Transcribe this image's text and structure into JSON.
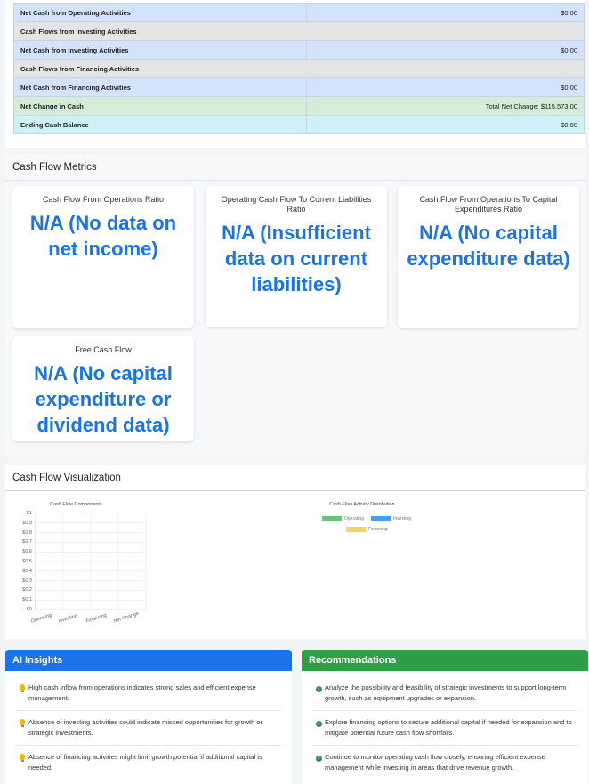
{
  "statement": {
    "rows": [
      {
        "label": "Net Cash from Operating Activities",
        "value": "$0.00",
        "style": "blue"
      },
      {
        "label": "Cash Flows from Investing Activities",
        "value": "",
        "style": "gray"
      },
      {
        "label": "Net Cash from Investing Activities",
        "value": "$0.00",
        "style": "blue"
      },
      {
        "label": "Cash Flows from Financing Activities",
        "value": "",
        "style": "gray"
      },
      {
        "label": "Net Cash from Financing Activities",
        "value": "$0.00",
        "style": "blue"
      },
      {
        "label": "Net Change in Cash",
        "value": "Total Net Change: $115,573.00",
        "style": "green"
      },
      {
        "label": "Ending Cash Balance",
        "value": "$0.00",
        "style": "cyan"
      }
    ]
  },
  "metrics": {
    "title": "Cash Flow Metrics",
    "cards": [
      {
        "title": "Cash Flow From Operations Ratio",
        "value": "N/A (No data on net income)"
      },
      {
        "title": "Operating Cash Flow To Current Liabilities Ratio",
        "value": "N/A (Insufficient data on current liabilities)"
      },
      {
        "title": "Cash Flow From Operations To Capital Expenditures Ratio",
        "value": "N/A (No capital expenditure data)"
      },
      {
        "title": "Free Cash Flow",
        "value": "N/A (No capital expenditure or dividend data)"
      }
    ]
  },
  "visualization": {
    "title": "Cash Flow Visualization",
    "chart_data": [
      {
        "type": "bar",
        "title": "Cash Flow Components",
        "categories": [
          "Operating",
          "Investing",
          "Financing",
          "Net Change"
        ],
        "values": [
          0,
          0,
          0,
          0
        ],
        "ylim": [
          0,
          1
        ],
        "yticks": [
          "$1",
          "$0.9",
          "$0.8",
          "$0.7",
          "$0.6",
          "$0.5",
          "$0.4",
          "$0.3",
          "$0.2",
          "$0.1",
          "$0"
        ],
        "grid": true
      },
      {
        "type": "pie",
        "title": "Cash Flow Activity Distribution",
        "legend": [
          {
            "name": "Operating",
            "color": "#6dbf7e"
          },
          {
            "name": "Investing",
            "color": "#4a9cf0"
          },
          {
            "name": "Financing",
            "color": "#f7d35a"
          }
        ],
        "legend_position": "top"
      }
    ]
  },
  "insights": {
    "title": "AI Insights",
    "color": "#1a73e8",
    "items": [
      "High cash inflow from operations indicates strong sales and efficient expense management.",
      "Absence of investing activities could indicate missed opportunities for growth or strategic investments.",
      "Absence of financing activities might limit growth potential if additional capital is needed."
    ]
  },
  "recommendations": {
    "title": "Recommendations",
    "color": "#2e9e47",
    "items": [
      "Analyze the possibility and feasibility of strategic investments to support long-term growth, such as equipment upgrades or expansion.",
      "Explore financing options to secure additional capital if needed for expansion and to mitigate potential future cash flow shortfalls.",
      "Continue to monitor operating cash flow closely, ensuring efficient expense management while investing in areas that drive revenue growth."
    ]
  }
}
